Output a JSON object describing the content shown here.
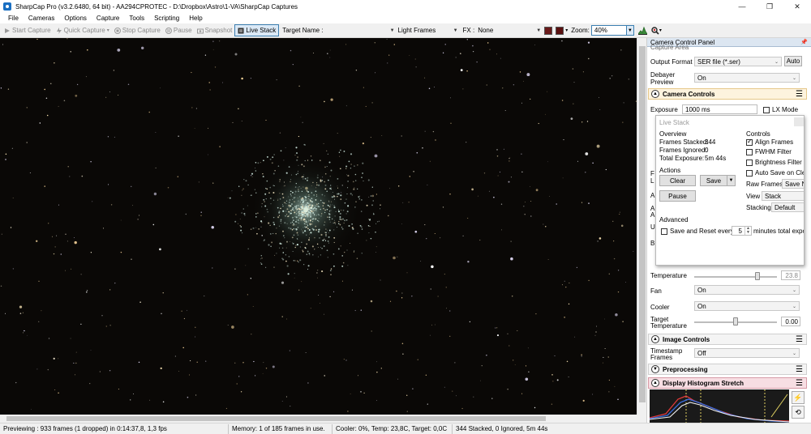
{
  "window": {
    "title": "SharpCap Pro (v3.2.6480, 64 bit) - AA294CPROTEC - D:\\Dropbox\\Astro\\1-VA\\SharpCap Captures",
    "minimize": "—",
    "maximize": "❐",
    "close": "✕"
  },
  "menu": [
    "File",
    "Cameras",
    "Options",
    "Capture",
    "Tools",
    "Scripting",
    "Help"
  ],
  "toolbar": {
    "start_capture": "Start Capture",
    "quick_capture": "Quick Capture",
    "stop_capture": "Stop Capture",
    "pause": "Pause",
    "snapshot": "Snapshot",
    "live_stack": "Live Stack",
    "target_name_label": "Target Name :",
    "target_name_value": "",
    "frame_type": "Light Frames",
    "fx_label": "FX :",
    "fx_value": "None",
    "zoom_label": "Zoom:",
    "zoom_value": "40%",
    "swatch1": "#6a1a1a",
    "swatch2": "#5a1010"
  },
  "panel": {
    "header": "Camera Control Panel",
    "capture_area_label": "Capture Area",
    "output_format_label": "Output Format",
    "output_format_value": "SER file (*.ser)",
    "auto_button": "Auto",
    "debayer_label": "Debayer Preview",
    "debayer_value": "On",
    "camera_controls": "Camera Controls",
    "exposure_label": "Exposure",
    "exposure_value": "1000 ms",
    "lx_mode": "LX Mode",
    "temperature_label": "Temperature",
    "temperature_value": "23.8",
    "fan_label": "Fan",
    "fan_value": "On",
    "cooler_label": "Cooler",
    "cooler_value": "On",
    "target_temp_label": "Target Temperature",
    "target_temp_value": "0.00",
    "image_controls": "Image Controls",
    "timestamp_label": "Timestamp Frames",
    "timestamp_value": "Off",
    "preprocessing": "Preprocessing",
    "histogram_stretch": "Display Histogram Stretch",
    "hidden_row_letters": [
      "F",
      "L",
      "A",
      "A",
      "A",
      "U",
      "B"
    ]
  },
  "live_stack": {
    "title": "Live Stack",
    "overview": "Overview",
    "frames_stacked_label": "Frames Stacked:",
    "frames_stacked_value": "344",
    "frames_ignored_label": "Frames Ignored:",
    "frames_ignored_value": "0",
    "total_exposure_label": "Total Exposure:",
    "total_exposure_value": "5m 44s",
    "actions": "Actions",
    "clear_button": "Clear",
    "save_button": "Save",
    "pause_button": "Pause",
    "controls": "Controls",
    "align_frames": "Align Frames",
    "fwhm_filter": "FWHM Filter",
    "brightness_filter": "Brightness Filter",
    "auto_save": "Auto Save on Clea",
    "raw_frames_label": "Raw Frames",
    "raw_frames_value": "Save No",
    "view_label": "View",
    "view_value": "Stack",
    "stacking_label": "Stacking",
    "stacking_value": "Default",
    "advanced": "Advanced",
    "save_reset_label": "Save and Reset every",
    "save_reset_value": "5",
    "save_reset_unit": "minutes total exposu"
  },
  "status": {
    "preview": "Previewing : 933 frames (1 dropped) in 0:14:37,8, 1,3 fps",
    "memory": "Memory: 1 of 185 frames in use.",
    "cooler": "Cooler: 0%, Temp: 23,8C, Target: 0,0C",
    "stack": "344 Stacked, 0 Ignored, 5m 44s"
  }
}
